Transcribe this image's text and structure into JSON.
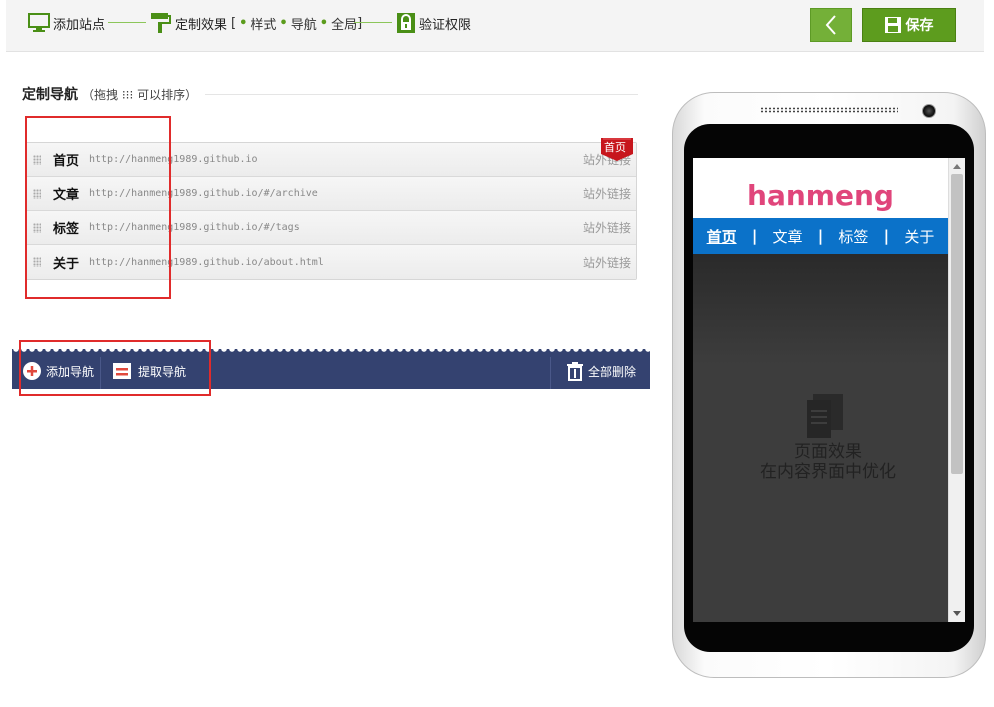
{
  "steps": {
    "add_site": "添加站点",
    "customize": "定制效果",
    "bracket_open": "[",
    "sub_style": "样式",
    "sub_nav": "导航",
    "sub_global": "全局",
    "bracket_close": "]",
    "verify": "验证权限"
  },
  "toolbar": {
    "save_label": "保存"
  },
  "section": {
    "title": "定制导航",
    "hint": "（拖拽 ⁝⁝⁝ 可以排序）"
  },
  "nav_items": [
    {
      "name": "首页",
      "url": "http://hanmeng1989.github.io",
      "type": "站外链接"
    },
    {
      "name": "文章",
      "url": "http://hanmeng1989.github.io/#/archive",
      "type": "站外链接"
    },
    {
      "name": "标签",
      "url": "http://hanmeng1989.github.io/#/tags",
      "type": "站外链接"
    },
    {
      "name": "关于",
      "url": "http://hanmeng1989.github.io/about.html",
      "type": "站外链接"
    }
  ],
  "home_flag": "首页",
  "actions": {
    "add": "添加导航",
    "extract": "提取导航",
    "delete_all": "全部删除"
  },
  "preview": {
    "logo": "hanmeng",
    "nav": [
      "首页",
      "文章",
      "标签",
      "关于"
    ],
    "separator": "|",
    "line1": "页面效果",
    "line2": "在内容界面中优化"
  },
  "colors": {
    "accent_green": "#5d9c1e",
    "action_bar": "#344270",
    "preview_nav": "#0b72c9",
    "logo": "#e0457b",
    "highlight": "#e02b2b"
  },
  "icons": [
    "monitor-icon",
    "paint-roller-icon",
    "lock-icon",
    "chevron-left-icon",
    "floppy-disk-icon",
    "drag-handle-icon",
    "plus-circle-icon",
    "extract-icon",
    "trash-icon",
    "document-icon"
  ]
}
